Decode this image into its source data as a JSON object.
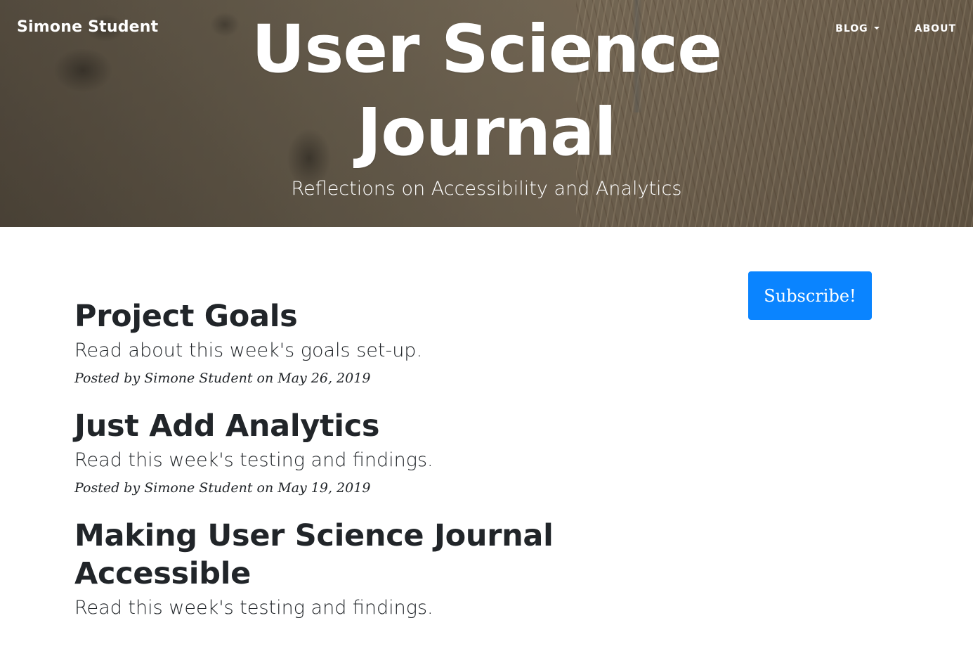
{
  "header": {
    "brand": "Simone Student",
    "nav": [
      {
        "label": "Blog",
        "dropdown": true
      },
      {
        "label": "About",
        "dropdown": false
      }
    ],
    "title": "User Science Journal",
    "subtitle": "Reflections on Accessibility and Analytics"
  },
  "sidebar": {
    "subscribe_label": "Subscribe!",
    "subscribe_color": "#0a84ff"
  },
  "posts": [
    {
      "title": "Project Goals",
      "subtitle": "Read about this week's goals set-up.",
      "meta_prefix": "Posted by ",
      "author": "Simone Student",
      "meta_on": " on ",
      "date": "May 26, 2019"
    },
    {
      "title": "Just Add Analytics",
      "subtitle": "Read this week's testing and findings.",
      "meta_prefix": "Posted by ",
      "author": "Simone Student",
      "meta_on": " on ",
      "date": "May 19, 2019"
    },
    {
      "title": "Making User Science Journal Accessible",
      "subtitle": "Read this week's testing and findings."
    }
  ]
}
